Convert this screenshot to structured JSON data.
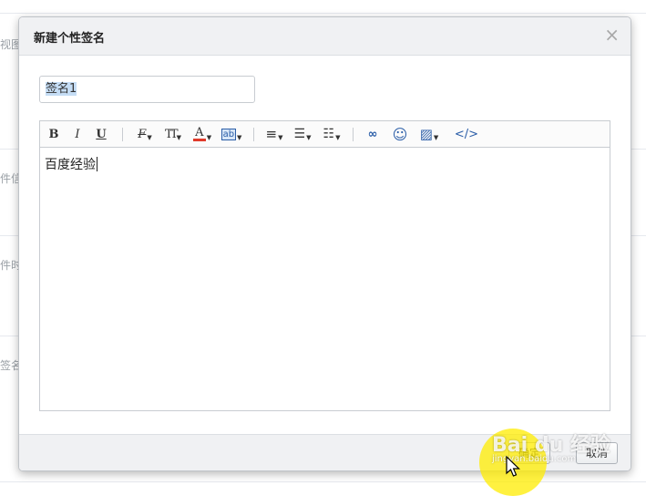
{
  "background": {
    "labels": [
      "视图",
      "件信",
      "件时",
      "签名"
    ]
  },
  "dialog": {
    "title": "新建个性签名",
    "close_glyph": "×",
    "name_input": {
      "value": "签名1"
    },
    "toolbar": [
      {
        "name": "bold-button",
        "glyph": "B"
      },
      {
        "name": "italic-button",
        "glyph": "I"
      },
      {
        "name": "underline-button",
        "glyph": "U"
      },
      {
        "name": "font-family-button",
        "glyph": "F"
      },
      {
        "name": "font-size-button",
        "glyph": "TT"
      },
      {
        "name": "font-color-button",
        "glyph": "A"
      },
      {
        "name": "highlight-color-button",
        "glyph": "ab"
      },
      {
        "name": "align-button",
        "glyph": "≡"
      },
      {
        "name": "bullet-list-button",
        "glyph": "☰"
      },
      {
        "name": "numbered-list-button",
        "glyph": "☷"
      },
      {
        "name": "link-button",
        "glyph": "∞"
      },
      {
        "name": "emoji-button",
        "glyph": "☺"
      },
      {
        "name": "image-button",
        "glyph": "▨"
      },
      {
        "name": "source-code-button",
        "glyph": "</>"
      }
    ],
    "editor_text": "百度经验",
    "buttons": {
      "ok": "确定",
      "cancel": "取消"
    }
  },
  "watermark": {
    "brand": "Bai du 经验",
    "url": "jingyan.baidu.com"
  },
  "colors": {
    "accent_blue": "#2b5ea8",
    "font_color_bar": "#e03a2a",
    "highlight": "#ffec00"
  }
}
